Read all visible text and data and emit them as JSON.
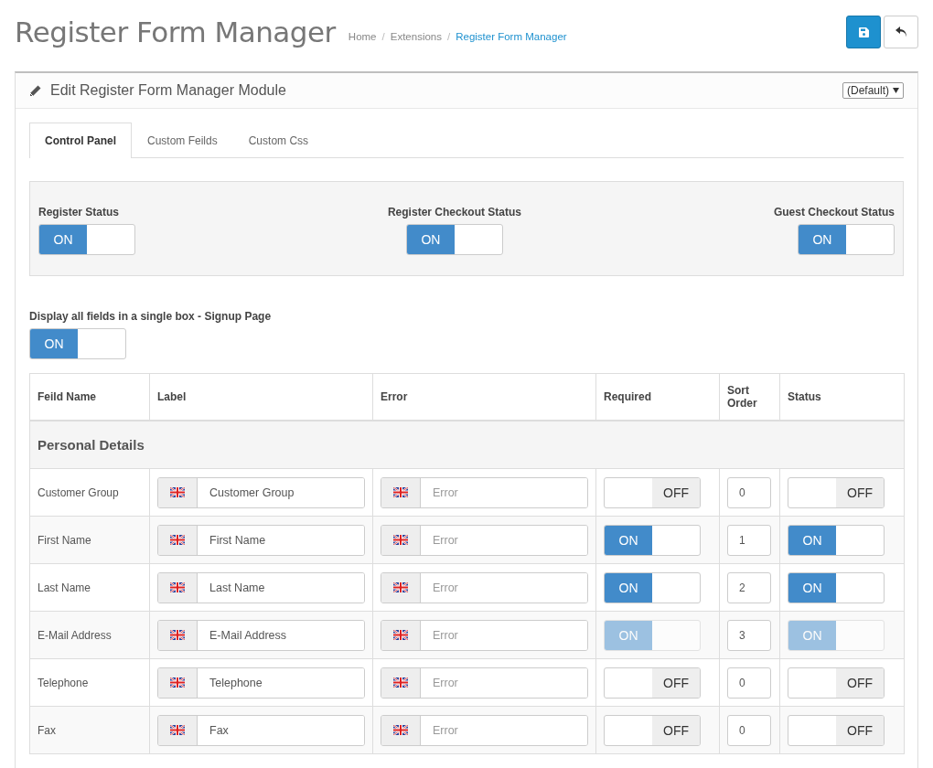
{
  "page": {
    "title": "Register Form Manager"
  },
  "breadcrumb": [
    {
      "label": "Home",
      "selected": false
    },
    {
      "label": "Extensions",
      "selected": false
    },
    {
      "label": "Register Form Manager",
      "selected": true
    }
  ],
  "breadcrumb_separator": "/",
  "panel": {
    "title": "Edit Register Form Manager Module",
    "store_select": "(Default)"
  },
  "tabs": [
    {
      "label": "Control Panel",
      "selected": true
    },
    {
      "label": "Custom Feilds",
      "selected": false
    },
    {
      "label": "Custom Css",
      "selected": false
    }
  ],
  "status_settings": [
    {
      "label": "Register Status",
      "toggle": {
        "on": true,
        "disabled": false,
        "text": "ON"
      }
    },
    {
      "label": "Register Checkout Status",
      "toggle": {
        "on": true,
        "disabled": false,
        "text": "ON"
      }
    },
    {
      "label": "Guest Checkout Status",
      "toggle": {
        "on": true,
        "disabled": false,
        "text": "ON"
      }
    }
  ],
  "single_box": {
    "label": "Display all fields in a single box - Signup Page",
    "toggle": {
      "on": true,
      "disabled": false,
      "text": "ON"
    }
  },
  "table": {
    "columns": [
      "Feild Name",
      "Label",
      "Error",
      "Required",
      "Sort Order",
      "Status"
    ],
    "section": "Personal Details",
    "rows": [
      {
        "name": "Customer Group",
        "label": "Customer Group",
        "error_placeholder": "Error",
        "required": {
          "on": false,
          "disabled": false,
          "text": "OFF"
        },
        "sort_order": "0",
        "status": {
          "on": false,
          "disabled": false,
          "text": "OFF"
        }
      },
      {
        "name": "First Name",
        "label": "First Name",
        "error_placeholder": "Error",
        "required": {
          "on": true,
          "disabled": false,
          "text": "ON"
        },
        "sort_order": "1",
        "status": {
          "on": true,
          "disabled": false,
          "text": "ON"
        }
      },
      {
        "name": "Last Name",
        "label": "Last Name",
        "error_placeholder": "Error",
        "required": {
          "on": true,
          "disabled": false,
          "text": "ON"
        },
        "sort_order": "2",
        "status": {
          "on": true,
          "disabled": false,
          "text": "ON"
        }
      },
      {
        "name": "E-Mail Address",
        "label": "E-Mail Address",
        "error_placeholder": "Error",
        "required": {
          "on": true,
          "disabled": true,
          "text": "ON"
        },
        "sort_order": "3",
        "status": {
          "on": true,
          "disabled": true,
          "text": "ON"
        }
      },
      {
        "name": "Telephone",
        "label": "Telephone",
        "error_placeholder": "Error",
        "required": {
          "on": false,
          "disabled": false,
          "text": "OFF"
        },
        "sort_order": "0",
        "status": {
          "on": false,
          "disabled": false,
          "text": "OFF"
        }
      },
      {
        "name": "Fax",
        "label": "Fax",
        "error_placeholder": "Error",
        "required": {
          "on": false,
          "disabled": false,
          "text": "OFF"
        },
        "sort_order": "0",
        "status": {
          "on": false,
          "disabled": false,
          "text": "OFF"
        }
      }
    ]
  }
}
